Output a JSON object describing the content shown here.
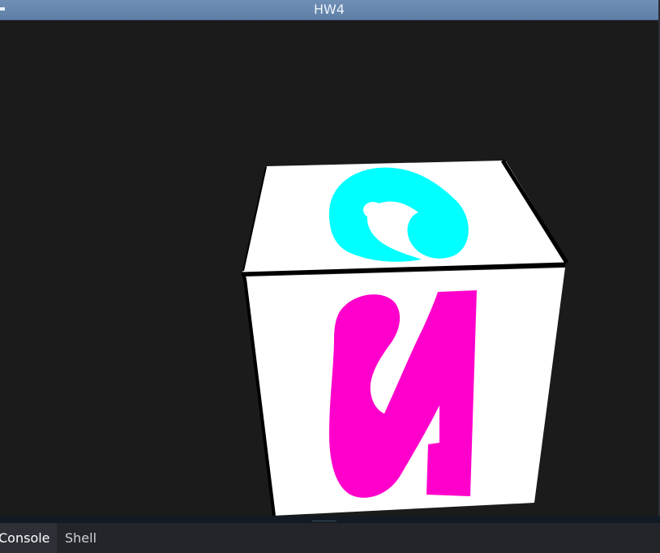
{
  "window": {
    "title": "HW4"
  },
  "viewport": {
    "background": "#1b1b1b",
    "object": "textured-cube",
    "faces": {
      "top": {
        "glyph_color": "#00ffff",
        "face_color": "#ffffff"
      },
      "front": {
        "glyph_color": "#ff00cc",
        "face_color": "#ffffff"
      }
    },
    "edge_color": "#000000"
  },
  "tabs": [
    {
      "label": "Console",
      "active": true
    },
    {
      "label": "Shell",
      "active": false
    }
  ],
  "colors": {
    "titlebar": "#6a8ab0",
    "tabbar": "#23252a",
    "splitter": "#121a24"
  }
}
